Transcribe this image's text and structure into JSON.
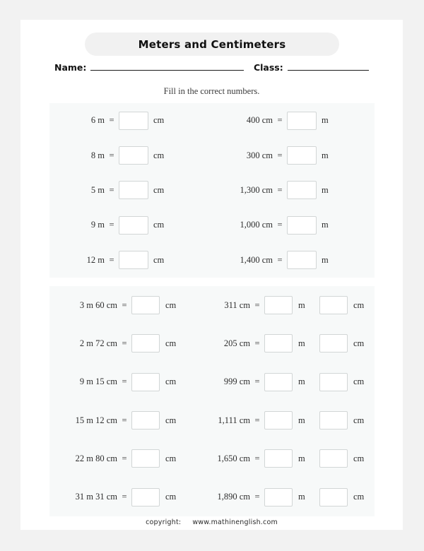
{
  "worksheet": {
    "title": "Meters and Centimeters",
    "name_label": "Name:",
    "class_label": "Class:",
    "instruction": "Fill in the correct numbers.",
    "footer": {
      "copyright_label": "copyright:",
      "site": "www.mathinenglish.com"
    },
    "colors": {
      "page_background": "#f2f2f2",
      "sheet": "#ffffff",
      "panel": "#f7f9f9",
      "title_pill": "#f1f1f1",
      "box_border": "#d2d6d6",
      "text": "#2d2d2d"
    }
  },
  "section1": {
    "left": [
      {
        "question": "6 m",
        "equals": "=",
        "unit": "cm"
      },
      {
        "question": "8 m",
        "equals": "=",
        "unit": "cm"
      },
      {
        "question": "5 m",
        "equals": "=",
        "unit": "cm"
      },
      {
        "question": "9 m",
        "equals": "=",
        "unit": "cm"
      },
      {
        "question": "12 m",
        "equals": "=",
        "unit": "cm"
      }
    ],
    "right": [
      {
        "question": "400 cm",
        "equals": "=",
        "unit": "m"
      },
      {
        "question": "300 cm",
        "equals": "=",
        "unit": "m"
      },
      {
        "question": "1,300 cm",
        "equals": "=",
        "unit": "m"
      },
      {
        "question": "1,000 cm",
        "equals": "=",
        "unit": "m"
      },
      {
        "question": "1,400 cm",
        "equals": "=",
        "unit": "m"
      }
    ]
  },
  "section2": {
    "left": [
      {
        "question": "3 m 60 cm",
        "equals": "=",
        "unit": "cm"
      },
      {
        "question": "2 m 72 cm",
        "equals": "=",
        "unit": "cm"
      },
      {
        "question": "9 m 15 cm",
        "equals": "=",
        "unit": "cm"
      },
      {
        "question": "15 m 12 cm",
        "equals": "=",
        "unit": "cm"
      },
      {
        "question": "22 m 80 cm",
        "equals": "=",
        "unit": "cm"
      },
      {
        "question": "31 m 31 cm",
        "equals": "=",
        "unit": "cm"
      }
    ],
    "right": [
      {
        "question": "311 cm",
        "equals": "=",
        "unit1": "m",
        "unit2": "cm"
      },
      {
        "question": "205 cm",
        "equals": "=",
        "unit1": "m",
        "unit2": "cm"
      },
      {
        "question": "999 cm",
        "equals": "=",
        "unit1": "m",
        "unit2": "cm"
      },
      {
        "question": "1,111 cm",
        "equals": "=",
        "unit1": "m",
        "unit2": "cm"
      },
      {
        "question": "1,650 cm",
        "equals": "=",
        "unit1": "m",
        "unit2": "cm"
      },
      {
        "question": "1,890 cm",
        "equals": "=",
        "unit1": "m",
        "unit2": "cm"
      }
    ]
  }
}
